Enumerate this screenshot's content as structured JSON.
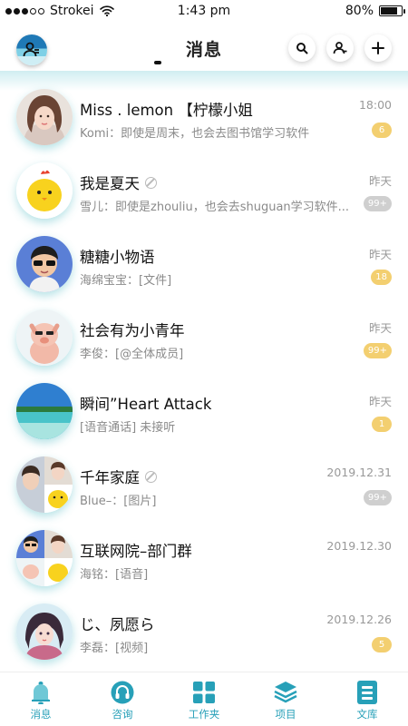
{
  "status_bar": {
    "carrier": "Strokei",
    "time": "1:43 pm",
    "battery": "80%",
    "battery_level": 0.8
  },
  "header": {
    "title": "消息"
  },
  "colors": {
    "accent": "#27a0b8",
    "badge_unread": "#f3cf70",
    "badge_muted": "#cfcfcf"
  },
  "conversations": [
    {
      "name": "Miss . lemon 【柠檬小姐",
      "preview": "Komi：即使是周末，也会去图书馆学习软件",
      "time": "18:00",
      "badge": "6",
      "badge_style": "yellow",
      "muted": false
    },
    {
      "name": "我是夏天",
      "preview": "雪儿：即使是zhouliu，也会去shuguan学习软件...",
      "time": "昨天",
      "badge": "99+",
      "badge_style": "gray",
      "muted": true
    },
    {
      "name": "糖糖小物语",
      "preview": "海绵宝宝：[文件]",
      "time": "昨天",
      "badge": "18",
      "badge_style": "yellow",
      "muted": false
    },
    {
      "name": "社会有为小青年",
      "preview": "李俊：[@全体成员]",
      "time": "昨天",
      "badge": "99+",
      "badge_style": "yellow",
      "muted": false
    },
    {
      "name": "瞬间”Heart Attack",
      "preview": "[语音通话] 未接听",
      "time": "昨天",
      "badge": "1",
      "badge_style": "yellow",
      "muted": false
    },
    {
      "name": "千年家庭",
      "preview": "Blue–：[图片]",
      "time": "2019.12.31",
      "badge": "99+",
      "badge_style": "gray",
      "muted": true
    },
    {
      "name": "互联网院–部门群",
      "preview": "海铭：[语音]",
      "time": "2019.12.30",
      "badge": "",
      "badge_style": "none",
      "muted": false
    },
    {
      "name": "じ、夙愿ら",
      "preview": "李磊：[视频]",
      "time": "2019.12.26",
      "badge": "5",
      "badge_style": "yellow",
      "muted": false
    }
  ],
  "tabs": [
    {
      "label": "消息",
      "icon": "bell-icon"
    },
    {
      "label": "咨询",
      "icon": "headset-icon"
    },
    {
      "label": "工作夹",
      "icon": "grid-icon"
    },
    {
      "label": "项目",
      "icon": "layers-icon"
    },
    {
      "label": "文库",
      "icon": "book-icon"
    }
  ]
}
